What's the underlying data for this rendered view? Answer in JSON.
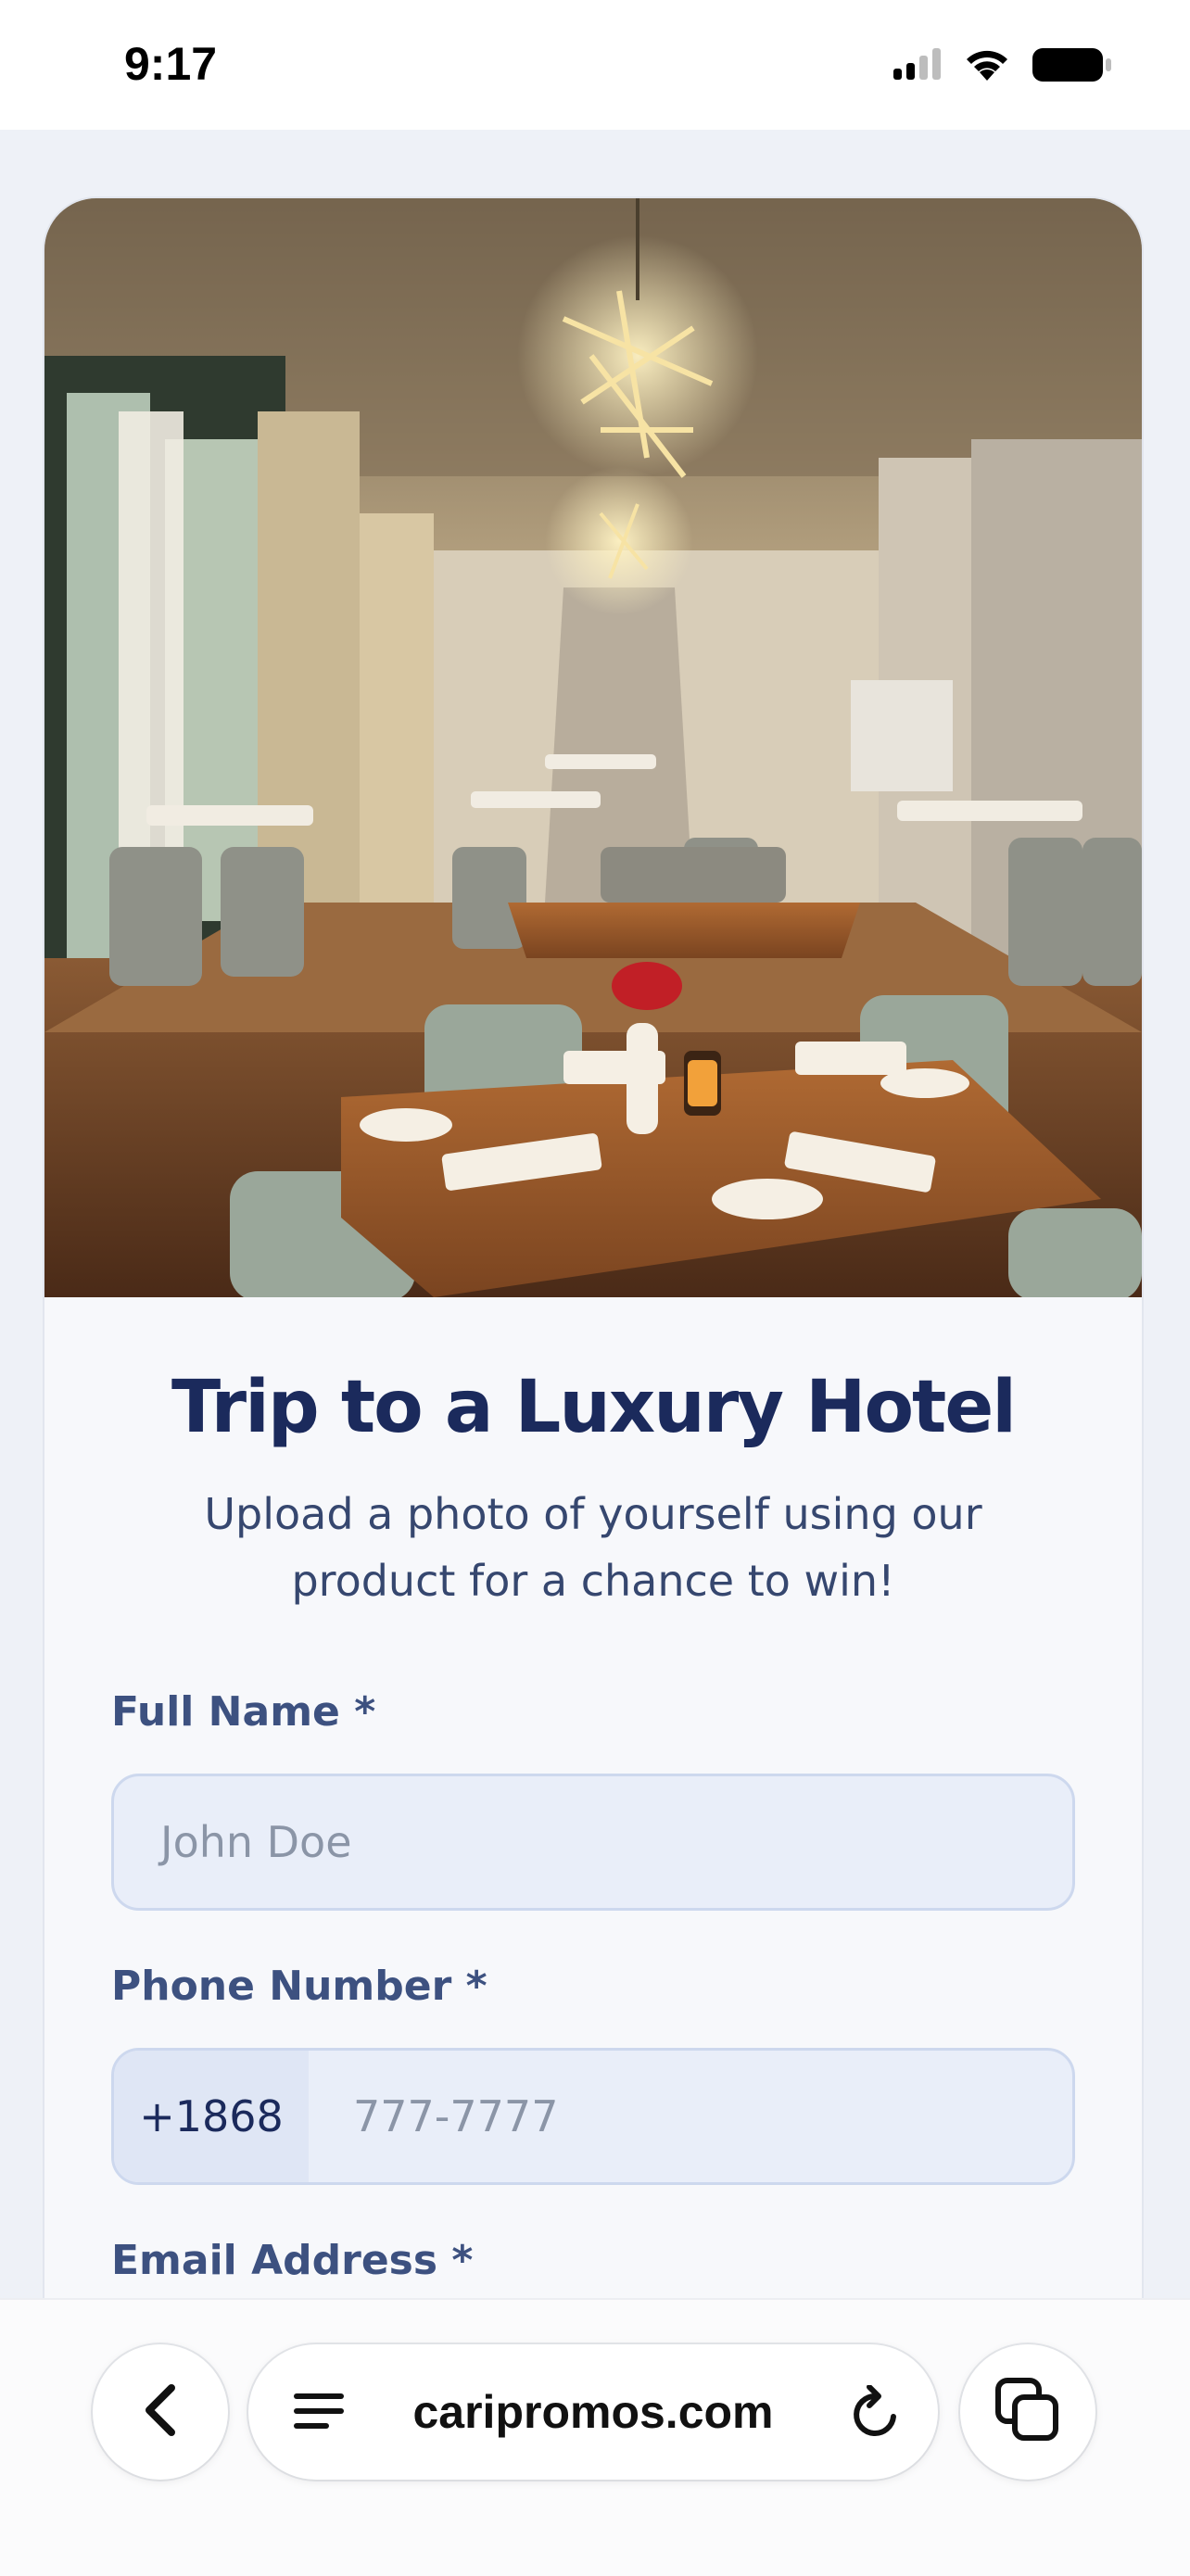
{
  "status": {
    "time": "9:17"
  },
  "form": {
    "title": "Trip to a Luxury Hotel",
    "subtitle": "Upload a photo of yourself using our product for a chance to win!",
    "full_name_label": "Full Name *",
    "full_name_placeholder": "John Doe",
    "phone_label": "Phone Number *",
    "phone_prefix": "+1868",
    "phone_placeholder": "777-7777",
    "email_label": "Email Address *"
  },
  "browser": {
    "url": "caripromos.com"
  },
  "colors": {
    "title": "#1b2a5c",
    "label": "#3d5180",
    "field_bg": "#e9eef9",
    "field_border": "#cdd8ee"
  }
}
